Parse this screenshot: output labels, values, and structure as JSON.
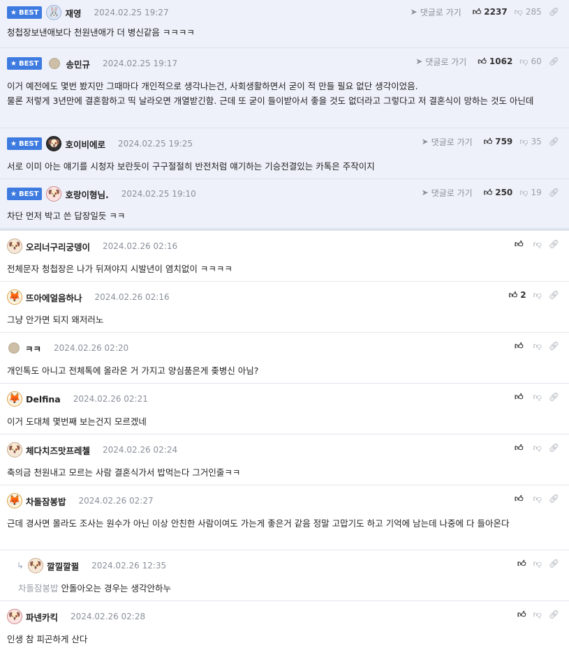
{
  "best_label": "BEST",
  "goto_label": "댓글로 가기",
  "best_comments": [
    {
      "name": "재영",
      "date": "2024.02.25 19:27",
      "up": "2237",
      "down": "285",
      "text": "청첩장보낸애보다 천원낸애가 더 병신같음 ㅋㅋㅋㅋ"
    },
    {
      "name": "송민규",
      "date": "2024.02.25 19:17",
      "up": "1062",
      "down": "60",
      "text": "이거 예전에도 몇번 봤지만 그때마다 개인적으로 생각나는건, 사회생활하면서 굳이 적 만들 필요 없단 생각이었음.\n물론 저렇게 3년만에 결혼함하고 띡 날라오면 개열받긴함. 근데 또 굳이 들이받아서 좋을 것도 없더라고 그렇다고 저 결혼식이 망하는 것도 아닌데"
    },
    {
      "name": "호이비에로",
      "date": "2024.02.25 19:25",
      "up": "759",
      "down": "35",
      "text": "서로 이미 아는 얘기를 시청자 보란듯이 구구절절히 반전처럼 얘기하는 기승전결있는 카톡은 주작이지"
    },
    {
      "name": "호랑이형님.",
      "date": "2024.02.25 19:10",
      "up": "250",
      "down": "19",
      "text": "차단 먼저 박고 쓴 답장일듯 ㅋㅋ"
    }
  ],
  "comments": [
    {
      "name": "오리너구리궁뎅이",
      "date": "2024.02.26 02:16",
      "up": "",
      "text": "전체문자 청첩장은 나가 뒤져야지 시발년이 염치없이 ㅋㅋㅋㅋ"
    },
    {
      "name": "뜨아에얼음하나",
      "date": "2024.02.26 02:16",
      "up": "2",
      "text": "그냥 안가면 되지 왜저러노"
    },
    {
      "name": "ㅋㅋ",
      "date": "2024.02.26 02:20",
      "up": "",
      "text": "개인톡도 아니고 전체톡에 올라온 거 가지고 양심품은게 좆병신 아님?"
    },
    {
      "name": "Delfina",
      "date": "2024.02.26 02:21",
      "up": "",
      "text": "이거 도대체 몇번째 보는건지 모르겠네"
    },
    {
      "name": "체다치즈맛프레첼",
      "date": "2024.02.26 02:24",
      "up": "",
      "text": "축의금 천원내고 모르는 사람 결혼식가서 밥먹는다 그거인줄ㅋㅋ"
    },
    {
      "name": "차돌잠봉밥",
      "date": "2024.02.26 02:27",
      "up": "",
      "text": "근데 경사면 몰라도 조사는 원수가 아닌 이상 안친한 사람이여도 가는게 좋은거 같음 정말 고맙기도 하고 기억에 남는데 나중에 다 들아온다"
    }
  ],
  "reply": {
    "name": "깔낄깔뀔",
    "date": "2024.02.26 12:35",
    "reply_to": "차돌잠봉밥",
    "text": "안돌아오는 경우는 생각안하누"
  },
  "last_comment": {
    "name": "파넨카킥",
    "date": "2024.02.26 02:28",
    "text": "인생 참 피곤하게 산다"
  },
  "icons": {
    "best": "star-icon",
    "goto": "arrow-icon",
    "up": "thumbs-up-icon",
    "down": "thumbs-down-icon",
    "link": "link-icon",
    "reply": "reply-arrow-icon"
  },
  "colors": {
    "best_badge": "#3e7be0",
    "best_bg": "#eef1fa"
  }
}
